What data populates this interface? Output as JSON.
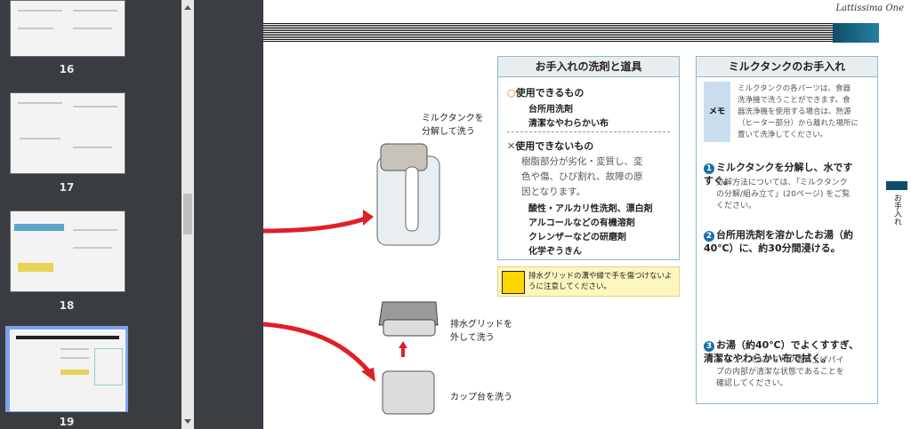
{
  "sidebar": {
    "pages": [
      {
        "label": "16"
      },
      {
        "label": "17"
      },
      {
        "label": "18"
      },
      {
        "label": "19"
      }
    ]
  },
  "document": {
    "brand": "Lattissima One",
    "step_milk": "ミルクタンクを\n分解して洗う",
    "step_grid": "排水グリッドを\n外して洗う",
    "step_cup": "カップ台を洗う",
    "cleaning": {
      "title": "お手入れの洗剤と道具",
      "usable_header": "使用できるもの",
      "usable": [
        "台所用洗剤",
        "清潔なやわらかい布"
      ],
      "unusable_header": "使用できないもの",
      "unusable_note": "樹脂部分が劣化・変質し、変\n色や傷、ひび割れ、故障の原\n因となります。",
      "unusable": [
        "酸性・アルカリ性洗剤、漂白剤",
        "アルコールなどの有機溶剤",
        "クレンザーなどの研磨剤",
        "化学ぞうきん"
      ],
      "warning": "排水グリッドの溝や縁で手を傷つけないように注意してください。"
    },
    "milk_care": {
      "title": "ミルクタンクのお手入れ",
      "memo_label": "メモ",
      "memo_text": "ミルクタンクの各パーツは、食器\n洗浄機で洗うことができます。食\n器洗浄機を使用する場合は、熱源\n（ヒーター部分）から離れた場所に\n置いて洗浄してください。",
      "step1_num": "1",
      "step1": "ミルクタンクを分解し、水です\nすぐ。",
      "step1_sub": "分解方法については、「ミルクタンク\nの分解/組み立て」(20ページ) をご覧\nください。",
      "step2_num": "2",
      "step2": "台所用洗剤を溶かしたお湯（約\n40℃）に、約30分間浸ける。",
      "step3_num": "3",
      "step3": "お湯（約40℃）でよくすすぎ、\n清潔なやわらかい布で拭く。",
      "step3_sub": "ミルクノズルやミルク吸い上げパイ\nプの内部が清潔な状態であることを\n確認してください。"
    },
    "side_tab": "お手入れ"
  }
}
